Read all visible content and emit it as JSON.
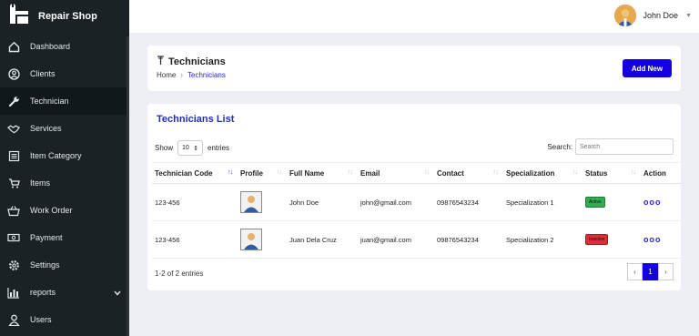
{
  "app": {
    "name": "Repair Shop"
  },
  "user": {
    "name": "John Doe"
  },
  "sidebar": {
    "items": [
      {
        "label": "Dashboard",
        "icon": "home-icon"
      },
      {
        "label": "Clients",
        "icon": "user-circle-icon"
      },
      {
        "label": "Technician",
        "icon": "wrench-icon",
        "active": true
      },
      {
        "label": "Services",
        "icon": "handshake-icon"
      },
      {
        "label": "Item Category",
        "icon": "list-icon"
      },
      {
        "label": "Items",
        "icon": "cart-icon"
      },
      {
        "label": "Work Order",
        "icon": "basket-icon"
      },
      {
        "label": "Payment",
        "icon": "money-icon"
      },
      {
        "label": "Settings",
        "icon": "gear-icon"
      },
      {
        "label": "reports",
        "icon": "chart-icon"
      },
      {
        "label": "Users",
        "icon": "user-icon"
      }
    ]
  },
  "header": {
    "title": "Technicians",
    "breadcrumb_home": "Home",
    "breadcrumb_current": "Technicians",
    "add_label": "Add New"
  },
  "list": {
    "title": "Technicians List",
    "show_label": "Show",
    "page_size": "10",
    "entries_label": "entries",
    "search_label": "Search:",
    "search_placeholder": "Search",
    "columns": [
      "Technician Code",
      "Profile",
      "Full Name",
      "Email",
      "Contact",
      "Specialization",
      "Status",
      "Action"
    ],
    "rows": [
      {
        "code": "123-456",
        "name": "John Doe",
        "email": "john@gmail.com",
        "contact": "09876543234",
        "specialization": "Specialization 1",
        "status": "Active",
        "status_color": "#2fae4f"
      },
      {
        "code": "123-456",
        "name": "Juan Dela Cruz",
        "email": "juan@gmail.com",
        "contact": "09876543234",
        "specialization": "Specialization 2",
        "status": "Inactive",
        "status_color": "#d9303a"
      }
    ],
    "action_glyph": "ooo",
    "footer": "1-2 of 2 entries",
    "current_page": "1"
  },
  "colors": {
    "accent": "#1500e0",
    "sidebar": "#1b2226"
  }
}
